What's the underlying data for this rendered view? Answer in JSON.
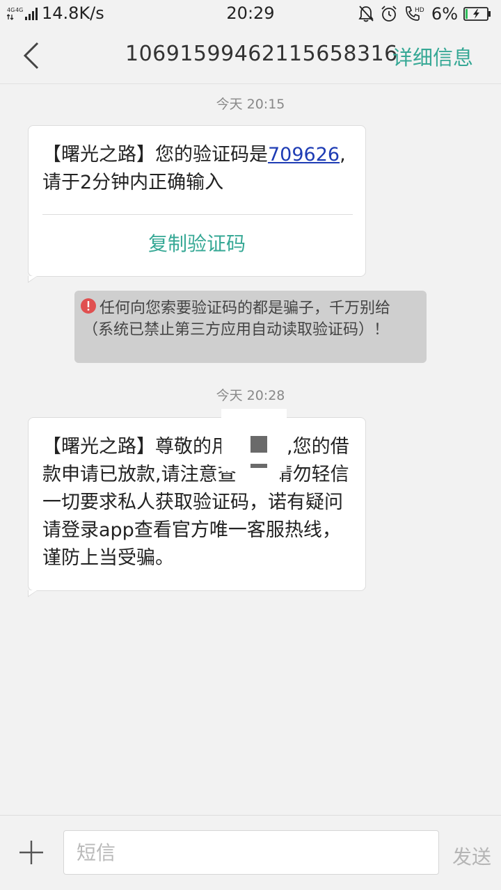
{
  "status_bar": {
    "network_label": "4G 4G",
    "speed": "14.8K/s",
    "time": "20:29",
    "battery": "6%"
  },
  "header": {
    "title": "10691599462115658316",
    "detail_label": "详细信息"
  },
  "messages": [
    {
      "timestamp": "今天  20:15",
      "prefix": "【曙光之路】您的验证码是",
      "code": "709626",
      "suffix": ",请于2分钟内正确输入",
      "copy_label": "复制验证码"
    },
    {
      "timestamp": "今天  20:28",
      "text": "【曙光之路】尊敬的用户您好,您的借款申请已放款,请注意查收。请勿轻信一切要求私人获取验证码，诺有疑问请登录app查看官方唯一客服热线，谨防上当受骗。"
    }
  ],
  "warning": {
    "text": "任何向您索要验证码的都是骗子，千万别给（系统已禁止第三方应用自动读取验证码）！"
  },
  "input_bar": {
    "placeholder": "短信",
    "send_label": "发送"
  },
  "colors": {
    "accent": "#36a895",
    "link": "#1e3cb4",
    "warning_bg": "#cfcfcf",
    "warning_icon": "#e05050"
  }
}
